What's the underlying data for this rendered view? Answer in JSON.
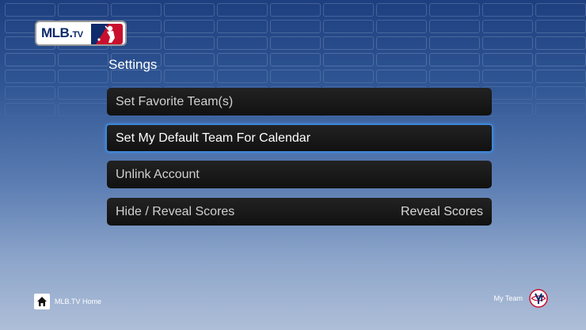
{
  "logo": {
    "brand_text": "MLB.",
    "brand_suffix": "TV"
  },
  "page_title": "Settings",
  "menu": [
    {
      "label": "Set Favorite Team(s)",
      "value": "",
      "selected": false
    },
    {
      "label": "Set My Default Team For Calendar",
      "value": "",
      "selected": true
    },
    {
      "label": "Unlink Account",
      "value": "",
      "selected": false
    },
    {
      "label": "Hide / Reveal Scores",
      "value": "Reveal Scores",
      "selected": false
    }
  ],
  "footer": {
    "home_label": "MLB.TV Home",
    "home_icon": "home-icon",
    "team_label": "My Team",
    "team_icon": "team-logo-icon"
  },
  "colors": {
    "background_top": "#1e3f7f",
    "background_bottom": "#aebed8",
    "menu_item": "#1a1a1a",
    "selection_border": "#3d87d9",
    "brand_navy": "#0d2a6b",
    "brand_red": "#c8102e"
  }
}
